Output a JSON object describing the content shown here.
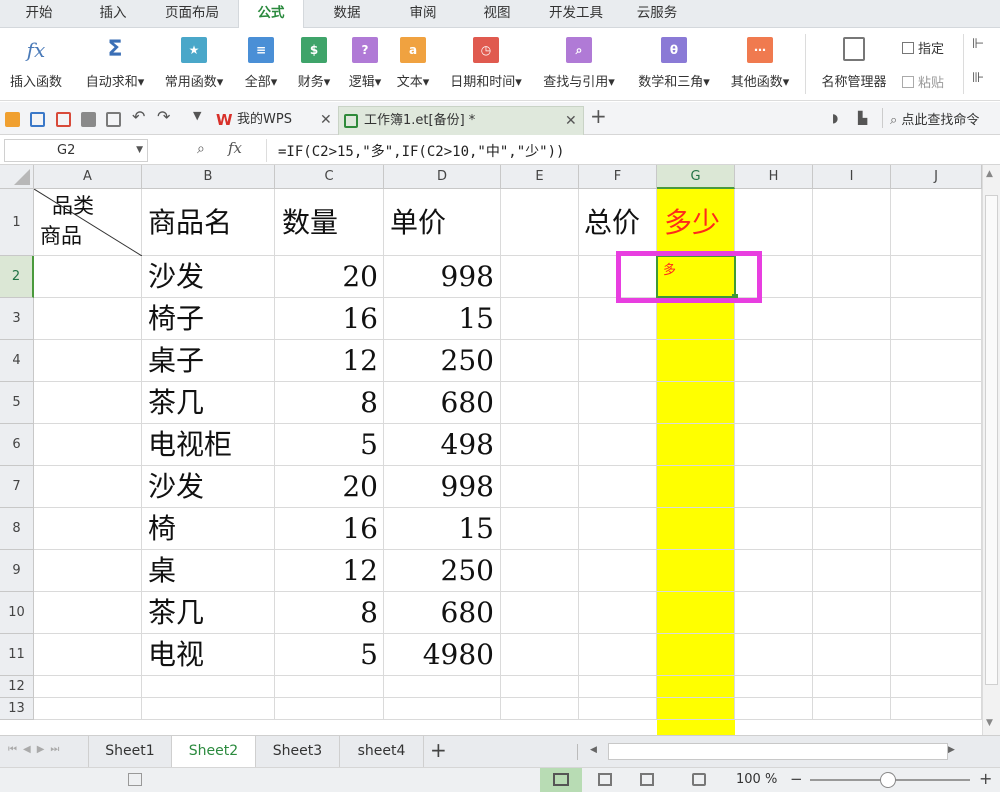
{
  "menu_tabs": [
    "开始",
    "插入",
    "页面布局",
    "公式",
    "数据",
    "审阅",
    "视图",
    "开发工具",
    "云服务"
  ],
  "active_menu_tab": "公式",
  "ribbon": {
    "insert_function": {
      "icon_text": "fx",
      "label": "插入函数"
    },
    "autosum": {
      "icon_text": "Σ",
      "label": "自动求和▾"
    },
    "groups": [
      {
        "label": "常用函数▾",
        "icon": "star-icon",
        "color": "#4aa7c9"
      },
      {
        "label": "全部▾",
        "icon": "list-icon",
        "color": "#4a8fd6"
      },
      {
        "label": "财务▾",
        "icon": "finance-icon",
        "color": "#3fa46a"
      },
      {
        "label": "逻辑▾",
        "icon": "logic-icon",
        "color": "#b07ad6"
      },
      {
        "label": "文本▾",
        "icon": "text-icon",
        "color": "#f0a240"
      },
      {
        "label": "日期和时间▾",
        "icon": "clock-icon",
        "color": "#e05a4f"
      },
      {
        "label": "查找与引用▾",
        "icon": "lookup-icon",
        "color": "#b07ad6"
      },
      {
        "label": "数学和三角▾",
        "icon": "theta-icon",
        "color": "#8a7ad6"
      },
      {
        "label": "其他函数▾",
        "icon": "more-icon",
        "color": "#f07a4f"
      }
    ],
    "name_manager": "名称管理器",
    "assign": "指定",
    "paste": "粘贴"
  },
  "doc_tabs": [
    {
      "label": "我的WPS",
      "icon": "wps-logo-icon"
    },
    {
      "label": "工作簿1.et[备份] *",
      "icon": "sheet-icon",
      "active": true
    }
  ],
  "search_command": "点此查找命令",
  "formula_bar": {
    "name_box": "G2",
    "fx": "fx",
    "formula": "=IF(C2>15,\"多\",IF(C2>10,\"中\",\"少\"))"
  },
  "columns": [
    "A",
    "B",
    "C",
    "D",
    "E",
    "F",
    "G",
    "H",
    "I",
    "J"
  ],
  "selected_column": "G",
  "selected_row": 2,
  "header_row": {
    "a1_top": "品类",
    "a1_bottom": "商品",
    "b1": "商品名",
    "c1": "数量",
    "d1": "单价",
    "f1": "总价",
    "g1": "多少"
  },
  "g2_value": "多",
  "rows": [
    {
      "num": "2",
      "name": "沙发",
      "qty": "20",
      "price": "998"
    },
    {
      "num": "3",
      "name": "椅子",
      "qty": "16",
      "price": "15"
    },
    {
      "num": "4",
      "name": "桌子",
      "qty": "12",
      "price": "250"
    },
    {
      "num": "5",
      "name": "茶几",
      "qty": "8",
      "price": "680"
    },
    {
      "num": "6",
      "name": "电视柜",
      "qty": "5",
      "price": "498"
    },
    {
      "num": "7",
      "name": "沙发",
      "qty": "20",
      "price": "998"
    },
    {
      "num": "8",
      "name": "椅",
      "qty": "16",
      "price": "15"
    },
    {
      "num": "9",
      "name": "桌",
      "qty": "12",
      "price": "250"
    },
    {
      "num": "10",
      "name": "茶几",
      "qty": "8",
      "price": "680"
    },
    {
      "num": "11",
      "name": "电视",
      "qty": "5",
      "price": "4980"
    }
  ],
  "empty_rows": [
    "12",
    "13"
  ],
  "sheets": [
    "Sheet1",
    "Sheet2",
    "Sheet3",
    "sheet4"
  ],
  "active_sheet": "Sheet2",
  "zoom": "100 %",
  "colors": {
    "highlight_column": "#ffff00",
    "g_text": "#ff2a1a",
    "selection_box": "#e83ee0",
    "accent": "#2b8a3e"
  }
}
